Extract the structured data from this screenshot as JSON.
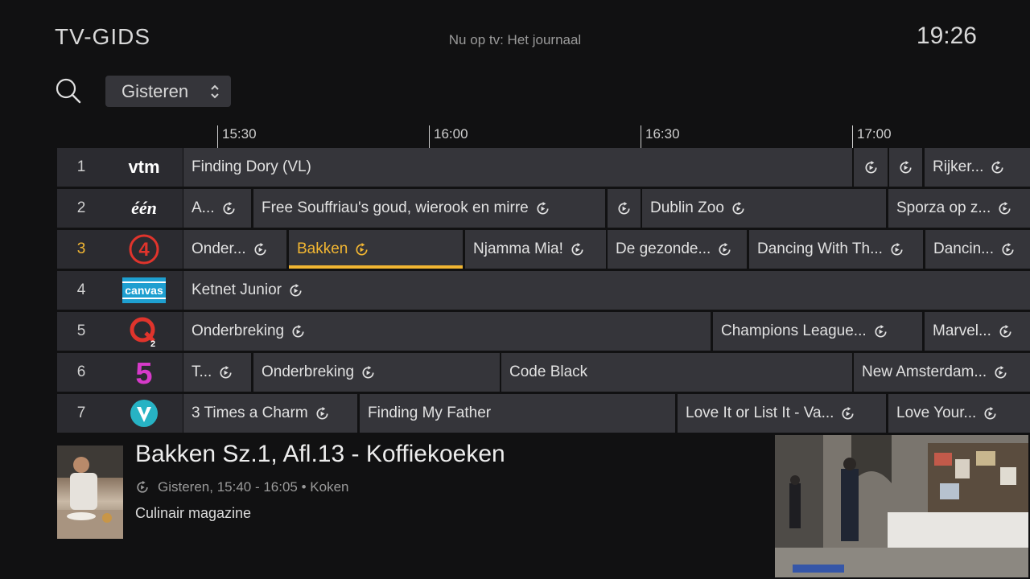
{
  "header": {
    "title": "TV-GIDS",
    "now_playing": "Nu op tv: Het journaal",
    "clock": "19:26"
  },
  "toolbar": {
    "day_selector": "Gisteren"
  },
  "timeline": [
    "15:30",
    "16:00",
    "16:30",
    "17:00"
  ],
  "channels": [
    {
      "number": "1",
      "logo": "vtm-logo",
      "programs": [
        {
          "title": "Finding Dory (VL)",
          "replay": false
        },
        {
          "title": "",
          "replay": true
        },
        {
          "title": "",
          "replay": true
        },
        {
          "title": "Rijker...",
          "replay": true
        }
      ]
    },
    {
      "number": "2",
      "logo": "een-logo",
      "programs": [
        {
          "title": "A...",
          "replay": true
        },
        {
          "title": "Free Souffriau's goud, wierook en mirre",
          "replay": true
        },
        {
          "title": "",
          "replay": true
        },
        {
          "title": "Dublin Zoo",
          "replay": true
        },
        {
          "title": "Sporza op z...",
          "replay": true
        }
      ]
    },
    {
      "number": "3",
      "logo": "vier-logo",
      "selected": true,
      "programs": [
        {
          "title": "Onder...",
          "replay": true
        },
        {
          "title": "Bakken",
          "replay": true,
          "selected": true
        },
        {
          "title": "Njamma Mia!",
          "replay": true
        },
        {
          "title": "De gezonde...",
          "replay": true
        },
        {
          "title": "Dancing With Th...",
          "replay": true
        },
        {
          "title": "Dancin...",
          "replay": true
        }
      ]
    },
    {
      "number": "4",
      "logo": "canvas-logo",
      "programs": [
        {
          "title": "Ketnet Junior",
          "replay": true
        }
      ]
    },
    {
      "number": "5",
      "logo": "q2-logo",
      "programs": [
        {
          "title": "Onderbreking",
          "replay": true
        },
        {
          "title": "Champions League...",
          "replay": true
        },
        {
          "title": "Marvel...",
          "replay": true
        }
      ]
    },
    {
      "number": "6",
      "logo": "vijf-logo",
      "programs": [
        {
          "title": "T...",
          "replay": true
        },
        {
          "title": "Onderbreking",
          "replay": true
        },
        {
          "title": "Code Black",
          "replay": false
        },
        {
          "title": "New Amsterdam...",
          "replay": true
        }
      ]
    },
    {
      "number": "7",
      "logo": "vtm2-logo",
      "programs": [
        {
          "title": "3 Times a Charm",
          "replay": true
        },
        {
          "title": "Finding My Father",
          "replay": false
        },
        {
          "title": "Love It or List It - Va...",
          "replay": true
        },
        {
          "title": "Love Your...",
          "replay": true
        }
      ]
    }
  ],
  "details": {
    "title": "Bakken Sz.1, Afl.13 - Koffiekoeken",
    "meta": "Gisteren,  15:40 - 16:05 • Koken",
    "description": "Culinair magazine"
  },
  "logo_texts": {
    "vtm": "vtm",
    "een": "één",
    "canvas": "canvas",
    "q2_sub": "2",
    "vier": "4",
    "vijf": "5"
  },
  "colors": {
    "accent": "#f2b632",
    "cell": "#35353a",
    "background": "#111112"
  }
}
